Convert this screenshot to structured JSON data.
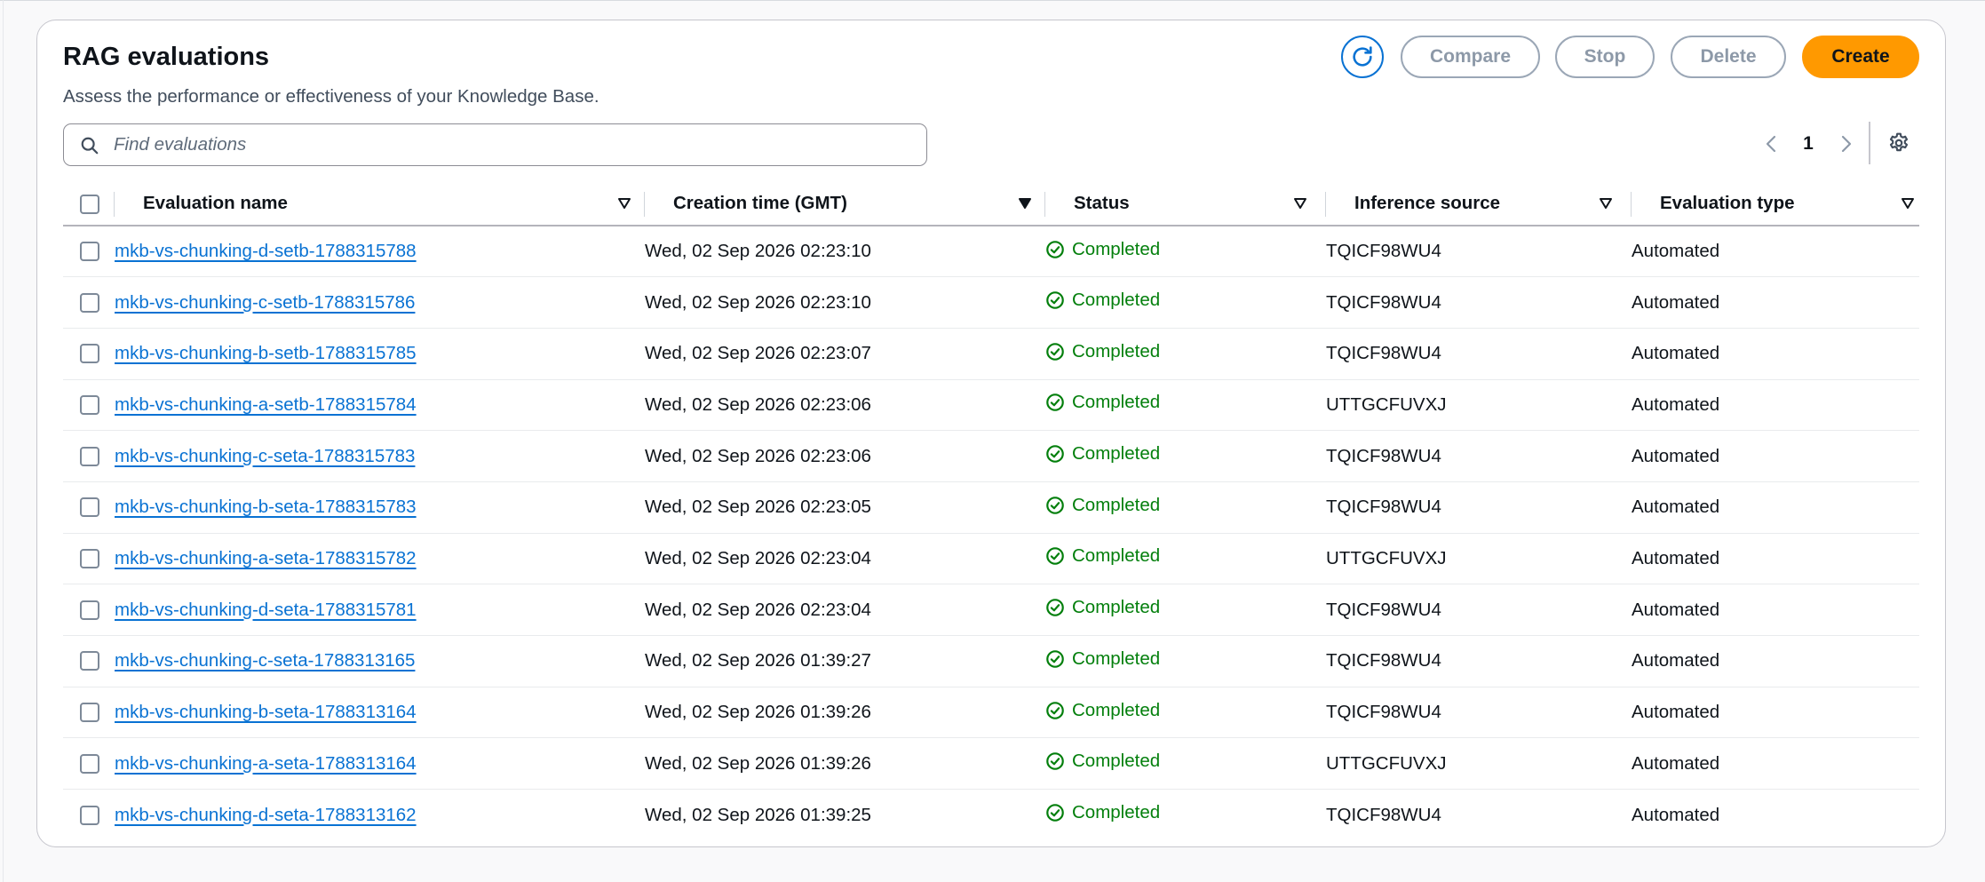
{
  "header": {
    "title": "RAG evaluations",
    "subtitle": "Assess the performance or effectiveness of your Knowledge Base."
  },
  "actions": {
    "refresh_icon": "refresh-icon",
    "compare_label": "Compare",
    "stop_label": "Stop",
    "delete_label": "Delete",
    "create_label": "Create"
  },
  "search": {
    "placeholder": "Find evaluations",
    "value": ""
  },
  "pagination": {
    "current_page": "1"
  },
  "colors": {
    "accent": "#0972d3",
    "primary_button": "#ff9900",
    "success": "#037f0c",
    "disabled": "#8d99a8"
  },
  "table": {
    "columns": [
      {
        "label": "Evaluation name",
        "sort": "unsorted"
      },
      {
        "label": "Creation time (GMT)",
        "sort": "sorted-desc"
      },
      {
        "label": "Status",
        "sort": "unsorted"
      },
      {
        "label": "Inference source",
        "sort": "unsorted"
      },
      {
        "label": "Evaluation type",
        "sort": "unsorted"
      }
    ],
    "rows": [
      {
        "name": "mkb-vs-chunking-d-setb-1788315788",
        "time": "Wed, 02 Sep 2026 02:23:10",
        "status": "Completed",
        "source": "TQICF98WU4",
        "type": "Automated"
      },
      {
        "name": "mkb-vs-chunking-c-setb-1788315786",
        "time": "Wed, 02 Sep 2026 02:23:10",
        "status": "Completed",
        "source": "TQICF98WU4",
        "type": "Automated"
      },
      {
        "name": "mkb-vs-chunking-b-setb-1788315785",
        "time": "Wed, 02 Sep 2026 02:23:07",
        "status": "Completed",
        "source": "TQICF98WU4",
        "type": "Automated"
      },
      {
        "name": "mkb-vs-chunking-a-setb-1788315784",
        "time": "Wed, 02 Sep 2026 02:23:06",
        "status": "Completed",
        "source": "UTTGCFUVXJ",
        "type": "Automated"
      },
      {
        "name": "mkb-vs-chunking-c-seta-1788315783",
        "time": "Wed, 02 Sep 2026 02:23:06",
        "status": "Completed",
        "source": "TQICF98WU4",
        "type": "Automated"
      },
      {
        "name": "mkb-vs-chunking-b-seta-1788315783",
        "time": "Wed, 02 Sep 2026 02:23:05",
        "status": "Completed",
        "source": "TQICF98WU4",
        "type": "Automated"
      },
      {
        "name": "mkb-vs-chunking-a-seta-1788315782",
        "time": "Wed, 02 Sep 2026 02:23:04",
        "status": "Completed",
        "source": "UTTGCFUVXJ",
        "type": "Automated"
      },
      {
        "name": "mkb-vs-chunking-d-seta-1788315781",
        "time": "Wed, 02 Sep 2026 02:23:04",
        "status": "Completed",
        "source": "TQICF98WU4",
        "type": "Automated"
      },
      {
        "name": "mkb-vs-chunking-c-seta-1788313165",
        "time": "Wed, 02 Sep 2026 01:39:27",
        "status": "Completed",
        "source": "TQICF98WU4",
        "type": "Automated"
      },
      {
        "name": "mkb-vs-chunking-b-seta-1788313164",
        "time": "Wed, 02 Sep 2026 01:39:26",
        "status": "Completed",
        "source": "TQICF98WU4",
        "type": "Automated"
      },
      {
        "name": "mkb-vs-chunking-a-seta-1788313164",
        "time": "Wed, 02 Sep 2026 01:39:26",
        "status": "Completed",
        "source": "UTTGCFUVXJ",
        "type": "Automated"
      },
      {
        "name": "mkb-vs-chunking-d-seta-1788313162",
        "time": "Wed, 02 Sep 2026 01:39:25",
        "status": "Completed",
        "source": "TQICF98WU4",
        "type": "Automated"
      }
    ]
  }
}
